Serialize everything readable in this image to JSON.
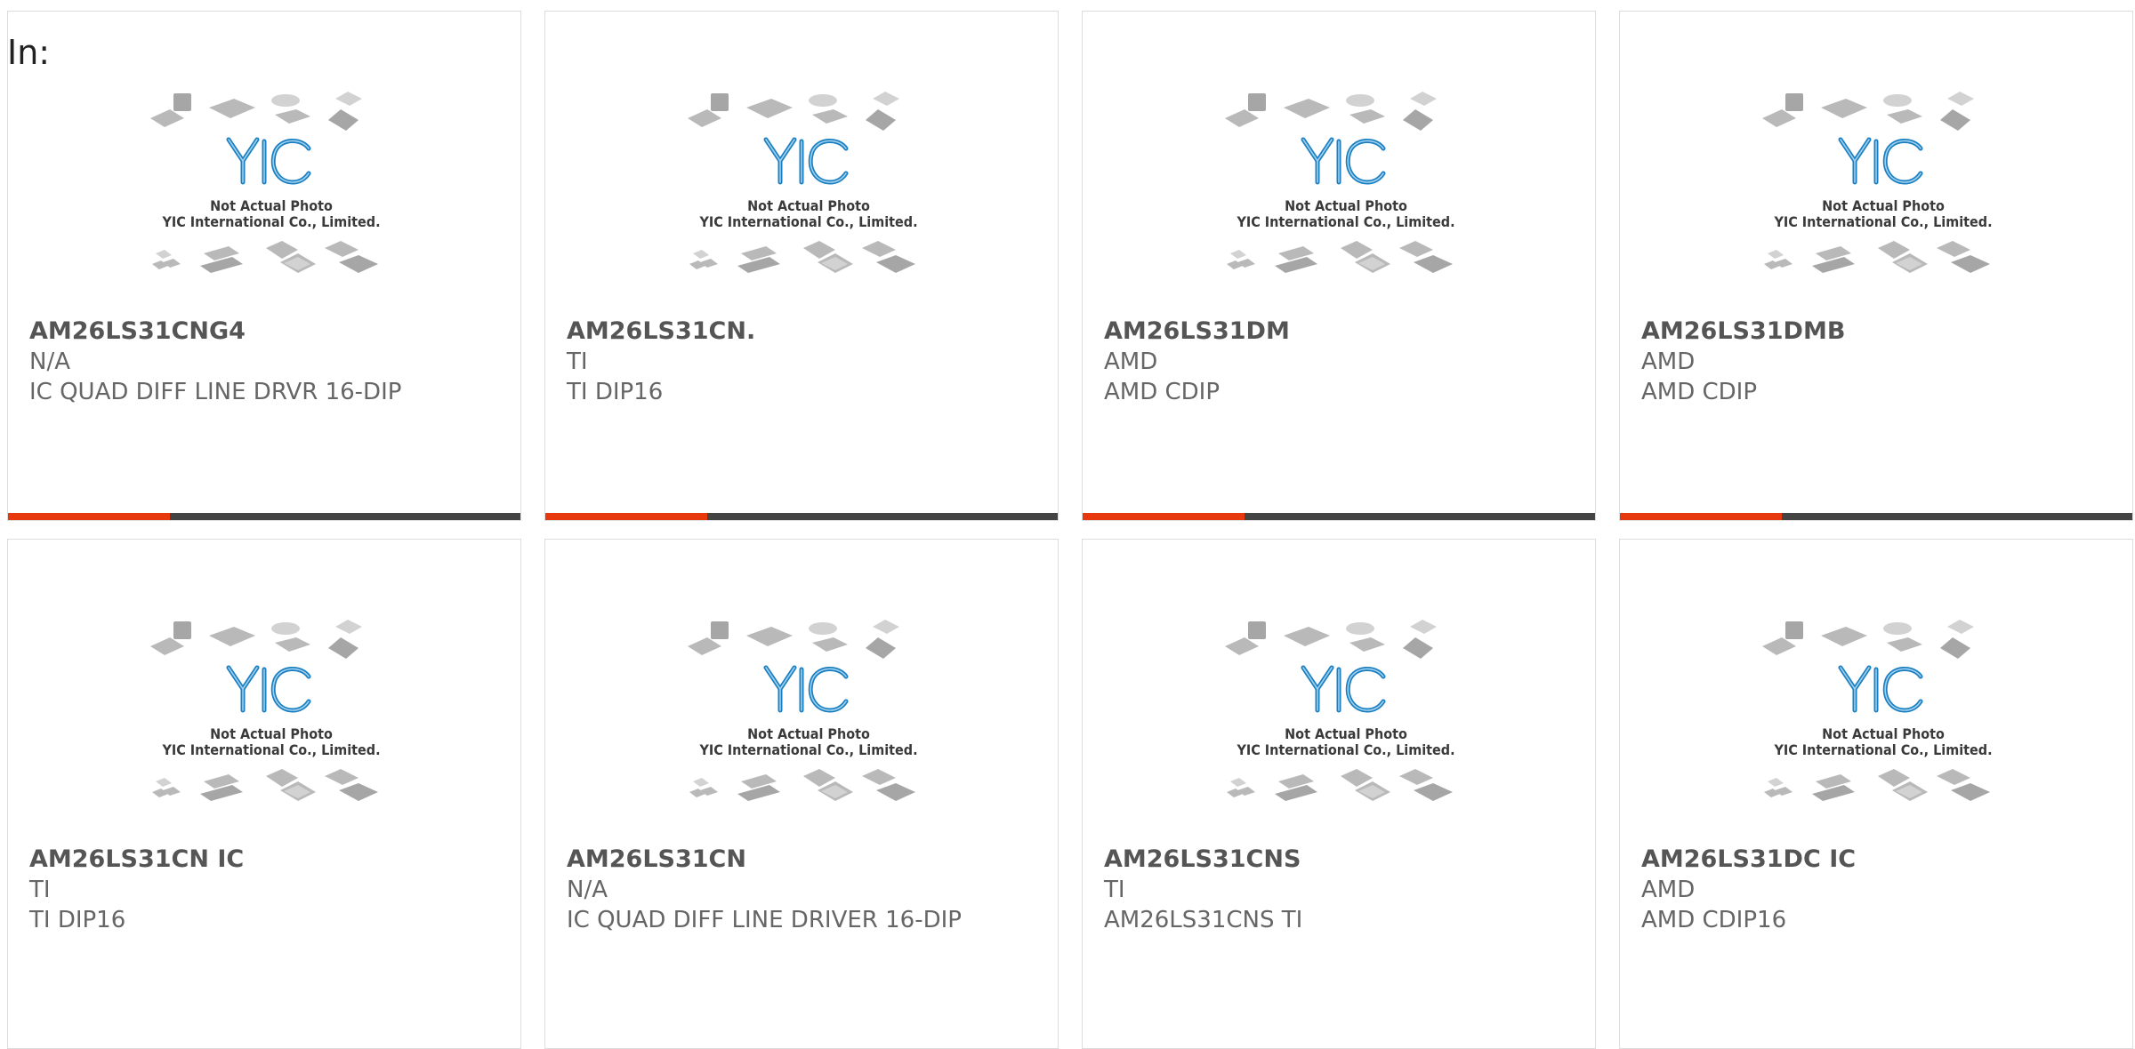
{
  "header": {
    "in_label": "In:"
  },
  "placeholder": {
    "line1": "Not Actual Photo",
    "line2": "YIC International Co., Limited.",
    "logo_text": "YIC"
  },
  "colors": {
    "accent": "#e8380d",
    "bar": "#444444",
    "logo": "#1a7fc1"
  },
  "products": [
    {
      "part": "AM26LS31CNG4",
      "manufacturer": "N/A",
      "description": "IC QUAD DIFF LINE DRVR 16-DIP"
    },
    {
      "part": "AM26LS31CN.",
      "manufacturer": "TI",
      "description": "TI DIP16"
    },
    {
      "part": "AM26LS31DM",
      "manufacturer": "AMD",
      "description": "AMD CDIP"
    },
    {
      "part": "AM26LS31DMB",
      "manufacturer": "AMD",
      "description": "AMD CDIP"
    },
    {
      "part": "AM26LS31CN IC",
      "manufacturer": "TI",
      "description": "TI DIP16"
    },
    {
      "part": "AM26LS31CN",
      "manufacturer": "N/A",
      "description": "IC QUAD DIFF LINE DRIVER 16-DIP"
    },
    {
      "part": "AM26LS31CNS",
      "manufacturer": "TI",
      "description": "AM26LS31CNS TI"
    },
    {
      "part": "AM26LS31DC IC",
      "manufacturer": "AMD",
      "description": "AMD CDIP16"
    }
  ]
}
